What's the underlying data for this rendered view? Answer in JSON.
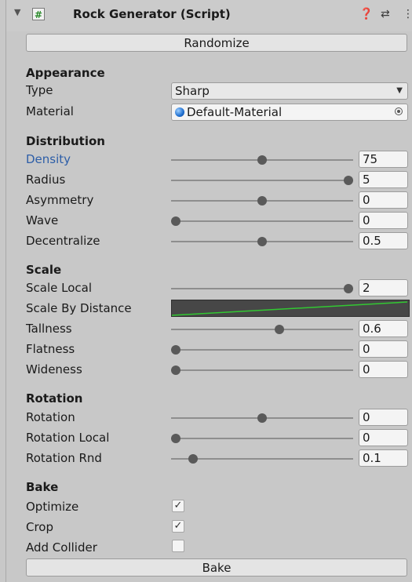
{
  "header": {
    "title": "Rock Generator (Script)",
    "script_icon": "#"
  },
  "buttons": {
    "randomize": "Randomize",
    "bake": "Bake"
  },
  "appearance": {
    "heading": "Appearance",
    "type_label": "Type",
    "type_value": "Sharp",
    "material_label": "Material",
    "material_value": "Default-Material"
  },
  "distribution": {
    "heading": "Distribution",
    "density": {
      "label": "Density",
      "value": "75",
      "slider": 0.5
    },
    "radius": {
      "label": "Radius",
      "value": "5",
      "slider": 1.0
    },
    "asymmetry": {
      "label": "Asymmetry",
      "value": "0",
      "slider": 0.5
    },
    "wave": {
      "label": "Wave",
      "value": "0",
      "slider": 0.0
    },
    "decentralize": {
      "label": "Decentralize",
      "value": "0.5",
      "slider": 0.5
    }
  },
  "scale": {
    "heading": "Scale",
    "scale_local": {
      "label": "Scale Local",
      "value": "2",
      "slider": 1.0
    },
    "scale_by_distance": {
      "label": "Scale By Distance",
      "curve_color": "#32c832"
    },
    "tallness": {
      "label": "Tallness",
      "value": "0.6",
      "slider": 0.6
    },
    "flatness": {
      "label": "Flatness",
      "value": "0",
      "slider": 0.0
    },
    "wideness": {
      "label": "Wideness",
      "value": "0",
      "slider": 0.0
    }
  },
  "rotation": {
    "heading": "Rotation",
    "rotation": {
      "label": "Rotation",
      "value": "0",
      "slider": 0.5
    },
    "rotation_local": {
      "label": "Rotation Local",
      "value": "0",
      "slider": 0.0
    },
    "rotation_rnd": {
      "label": "Rotation Rnd",
      "value": "0.1",
      "slider": 0.1
    }
  },
  "bake": {
    "heading": "Bake",
    "optimize": {
      "label": "Optimize",
      "checked": true
    },
    "crop": {
      "label": "Crop",
      "checked": true
    },
    "add_collider": {
      "label": "Add Collider",
      "checked": false
    }
  },
  "colors": {
    "panel_bg": "#c8c8c8",
    "label_highlight": "#2d5ea8"
  }
}
